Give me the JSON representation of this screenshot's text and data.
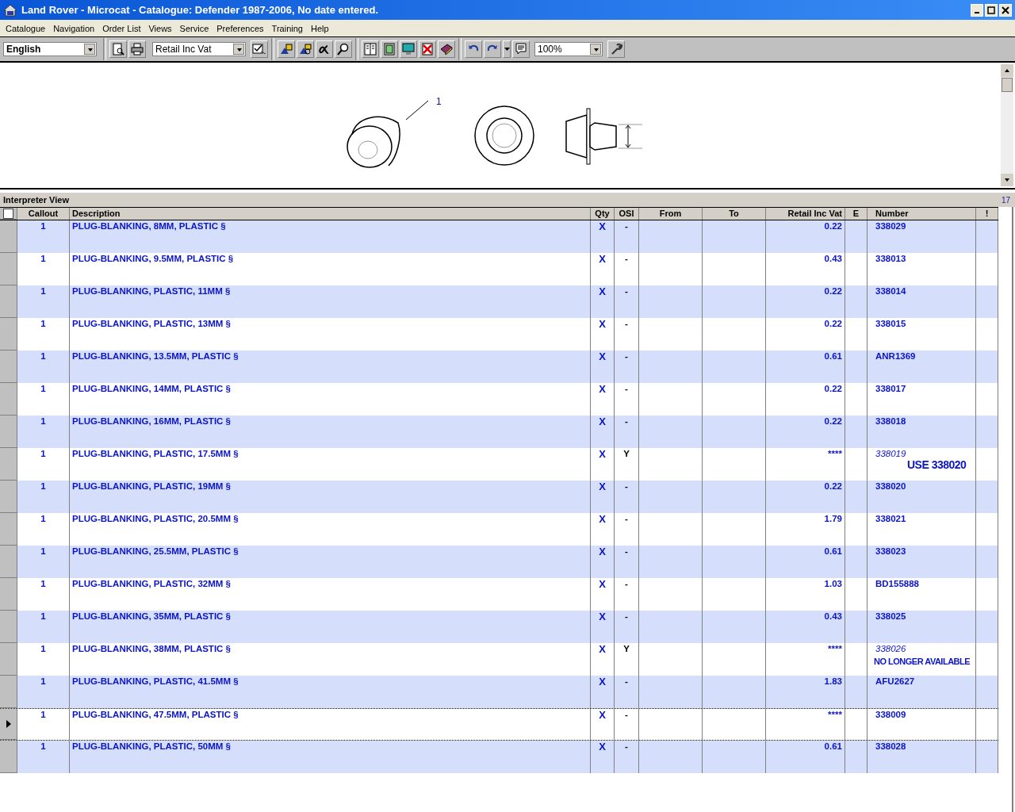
{
  "window": {
    "title": "Land Rover - Microcat - Catalogue: Defender 1987-2006, No date entered."
  },
  "menu": [
    "Catalogue",
    "Navigation",
    "Order List",
    "Views",
    "Service",
    "Preferences",
    "Training",
    "Help"
  ],
  "toolbar": {
    "language": "English",
    "price_type": "Retail Inc Vat",
    "zoom": "100%"
  },
  "diagram": {
    "callout": "1"
  },
  "panel": {
    "title": "Interpreter View",
    "count": "17"
  },
  "table": {
    "select_all_checked": false,
    "columns": [
      "Callout",
      "Description",
      "Qty",
      "OSI",
      "From",
      "To",
      "Retail Inc Vat",
      "E",
      "Number",
      "!"
    ],
    "rows": [
      {
        "callout": "1",
        "description": "PLUG-BLANKING, 8MM, PLASTIC §",
        "qty": "X",
        "osi": "-",
        "price": "0.22",
        "number": "338029",
        "superseded": false,
        "selected": false
      },
      {
        "callout": "1",
        "description": "PLUG-BLANKING, 9.5MM, PLASTIC §",
        "qty": "X",
        "osi": "-",
        "price": "0.43",
        "number": "338013",
        "superseded": false,
        "selected": false
      },
      {
        "callout": "1",
        "description": "PLUG-BLANKING, PLASTIC, 11MM §",
        "qty": "X",
        "osi": "-",
        "price": "0.22",
        "number": "338014",
        "superseded": false,
        "selected": false
      },
      {
        "callout": "1",
        "description": "PLUG-BLANKING, PLASTIC, 13MM §",
        "qty": "X",
        "osi": "-",
        "price": "0.22",
        "number": "338015",
        "superseded": false,
        "selected": false
      },
      {
        "callout": "1",
        "description": "PLUG-BLANKING, 13.5MM, PLASTIC §",
        "qty": "X",
        "osi": "-",
        "price": "0.61",
        "number": "ANR1369",
        "superseded": false,
        "selected": false
      },
      {
        "callout": "1",
        "description": "PLUG-BLANKING, 14MM, PLASTIC §",
        "qty": "X",
        "osi": "-",
        "price": "0.22",
        "number": "338017",
        "superseded": false,
        "selected": false
      },
      {
        "callout": "1",
        "description": "PLUG-BLANKING, 16MM, PLASTIC §",
        "qty": "X",
        "osi": "-",
        "price": "0.22",
        "number": "338018",
        "superseded": false,
        "selected": false
      },
      {
        "callout": "1",
        "description": "PLUG-BLANKING, PLASTIC, 17.5MM §",
        "qty": "X",
        "osi": "Y",
        "price": "****",
        "number": "338019",
        "superseded": true,
        "replacement": "USE 338020",
        "selected": false
      },
      {
        "callout": "1",
        "description": "PLUG-BLANKING, PLASTIC, 19MM §",
        "qty": "X",
        "osi": "-",
        "price": "0.22",
        "number": "338020",
        "superseded": false,
        "selected": false
      },
      {
        "callout": "1",
        "description": "PLUG-BLANKING, PLASTIC, 20.5MM §",
        "qty": "X",
        "osi": "-",
        "price": "1.79",
        "number": "338021",
        "superseded": false,
        "selected": false
      },
      {
        "callout": "1",
        "description": "PLUG-BLANKING, 25.5MM, PLASTIC §",
        "qty": "X",
        "osi": "-",
        "price": "0.61",
        "number": "338023",
        "superseded": false,
        "selected": false
      },
      {
        "callout": "1",
        "description": "PLUG-BLANKING, PLASTIC, 32MM §",
        "qty": "X",
        "osi": "-",
        "price": "1.03",
        "number": "BD155888",
        "superseded": false,
        "selected": false
      },
      {
        "callout": "1",
        "description": "PLUG-BLANKING, 35MM, PLASTIC §",
        "qty": "X",
        "osi": "-",
        "price": "0.43",
        "number": "338025",
        "superseded": false,
        "selected": false
      },
      {
        "callout": "1",
        "description": "PLUG-BLANKING, 38MM, PLASTIC §",
        "qty": "X",
        "osi": "Y",
        "price": "****",
        "number": "338026",
        "superseded": true,
        "status_note": "NO LONGER AVAILABLE",
        "selected": false
      },
      {
        "callout": "1",
        "description": "PLUG-BLANKING, PLASTIC, 41.5MM §",
        "qty": "X",
        "osi": "-",
        "price": "1.83",
        "number": "AFU2627",
        "superseded": false,
        "selected": false
      },
      {
        "callout": "1",
        "description": "PLUG-BLANKING, 47.5MM, PLASTIC §",
        "qty": "X",
        "osi": "-",
        "price": "****",
        "number": "338009",
        "superseded": false,
        "selected": true
      },
      {
        "callout": "1",
        "description": "PLUG-BLANKING, PLASTIC, 50MM §",
        "qty": "X",
        "osi": "-",
        "price": "0.61",
        "number": "338028",
        "superseded": false,
        "selected": false
      }
    ]
  }
}
